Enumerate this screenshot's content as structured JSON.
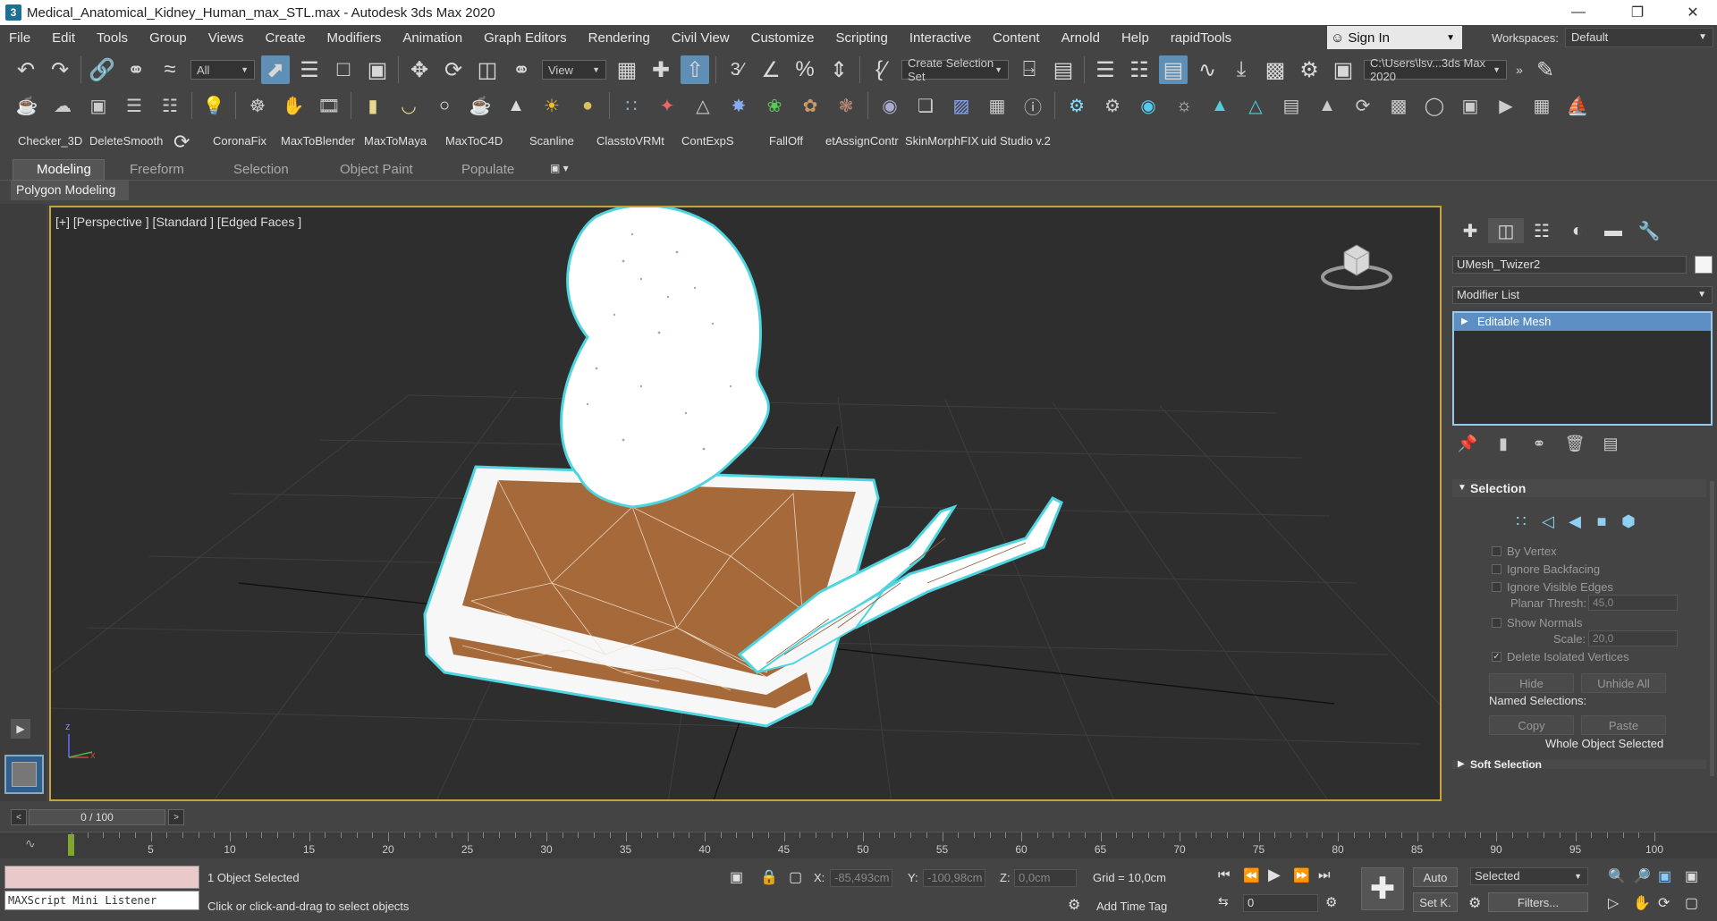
{
  "window": {
    "title": "Medical_Anatomical_Kidney_Human_max_STL.max - Autodesk 3ds Max 2020",
    "app_icon": "3"
  },
  "menu": [
    "File",
    "Edit",
    "Tools",
    "Group",
    "Views",
    "Create",
    "Modifiers",
    "Animation",
    "Graph Editors",
    "Rendering",
    "Civil View",
    "Customize",
    "Scripting",
    "Interactive",
    "Content",
    "Arnold",
    "Help",
    "rapidTools"
  ],
  "account": {
    "sign_in": "Sign In",
    "workspaces_label": "Workspaces:",
    "workspace": "Default"
  },
  "main_toolbar": {
    "selection_filter": "All",
    "ref_coord": "View",
    "named_selection": "Create Selection Set",
    "project_path": "C:\\Users\\lsv...3ds Max 2020"
  },
  "script_buttons": [
    "Checker_3D",
    "DeleteSmooth",
    "CoronaFix",
    "MaxToBlender",
    "MaxToMaya",
    "MaxToC4D",
    "Scanline",
    "ClasstoVRMt",
    "ContExpS",
    "FallOff",
    "etAssignContr",
    "SkinMorphFIX",
    "uid Studio v.2"
  ],
  "ribbon": {
    "tabs": [
      "Modeling",
      "Freeform",
      "Selection",
      "Object Paint",
      "Populate"
    ],
    "active": "Modeling",
    "panel": "Polygon Modeling"
  },
  "viewport": {
    "label": "[+] [Perspective ] [Standard ] [Edged Faces ]",
    "axis_x": "x",
    "axis_z": "z"
  },
  "command_panel": {
    "object_name": "UMesh_Twizer2",
    "modifier_list": "Modifier List",
    "stack_item": "Editable Mesh",
    "rollout_selection": "Selection",
    "by_vertex": "By Vertex",
    "ignore_backfacing": "Ignore Backfacing",
    "ignore_visible_edges": "Ignore Visible Edges",
    "planar_thresh_label": "Planar Thresh:",
    "planar_thresh": "45,0",
    "show_normals": "Show Normals",
    "scale_label": "Scale:",
    "scale": "20,0",
    "delete_isolated": "Delete Isolated Vertices",
    "hide": "Hide",
    "unhide_all": "Unhide All",
    "named_selections": "Named Selections:",
    "copy": "Copy",
    "paste": "Paste",
    "whole_object": "Whole Object Selected",
    "soft_selection": "Soft Selection"
  },
  "timeline": {
    "frame": "0 / 100",
    "ticks": [
      "5",
      "10",
      "15",
      "20",
      "25",
      "30",
      "35",
      "40",
      "45",
      "50",
      "55",
      "60",
      "65",
      "70",
      "75",
      "80",
      "85",
      "90",
      "95",
      "100"
    ]
  },
  "status": {
    "listener": "MAXScript Mini Listener",
    "selected": "1 Object Selected",
    "prompt": "Click or click-and-drag to select objects",
    "x_label": "X:",
    "x": "-85,493cm",
    "y_label": "Y:",
    "y": "-100,98cm",
    "z_label": "Z:",
    "z": "0,0cm",
    "grid": "Grid = 10,0cm",
    "add_time_tag": "Add Time Tag",
    "auto": "Auto",
    "set_key": "Set K.",
    "key_filter": "Selected",
    "filters": "Filters...",
    "current_frame": "0"
  }
}
